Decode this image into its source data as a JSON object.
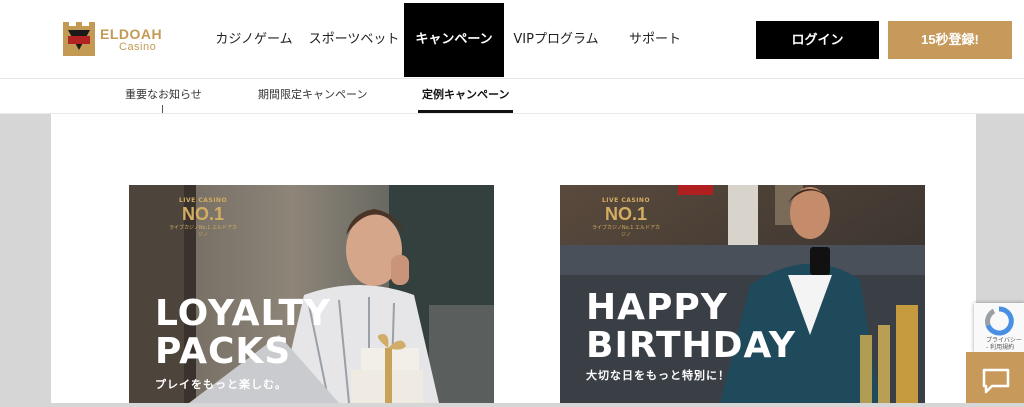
{
  "brand": {
    "name": "ELDOAH",
    "sub": "Casino"
  },
  "nav": {
    "items": [
      "カジノゲーム",
      "スポーツベット",
      "キャンペーン",
      "VIPプログラム",
      "サポート"
    ],
    "active_index": 2
  },
  "actions": {
    "login": "ログイン",
    "register": "15秒登録!"
  },
  "subnav": {
    "items": [
      "重要なお知らせ",
      "期間限定キャンペーン",
      "定例キャンペーン"
    ],
    "active_index": 2
  },
  "banners": [
    {
      "title_line1": "LOYALTY",
      "title_line2": "PACKS",
      "subtitle": "プレイをもっと楽しむ。",
      "badge": {
        "top": "LIVE CASINO",
        "main": "NO.1",
        "jp": "ライブカジノNo.1 エルドアカジノ"
      }
    },
    {
      "title_line1": "HAPPY",
      "title_line2": "BIRTHDAY",
      "subtitle": "大切な日をもっと特別に！",
      "badge": {
        "top": "LIVE CASINO",
        "main": "NO.1",
        "jp": "ライブカジノNo.1 エルドアカジノ"
      }
    }
  ],
  "recaptcha": {
    "label": "プライバシー - 利用規約"
  },
  "colors": {
    "accent": "#c79a5c",
    "dark": "#000000"
  }
}
